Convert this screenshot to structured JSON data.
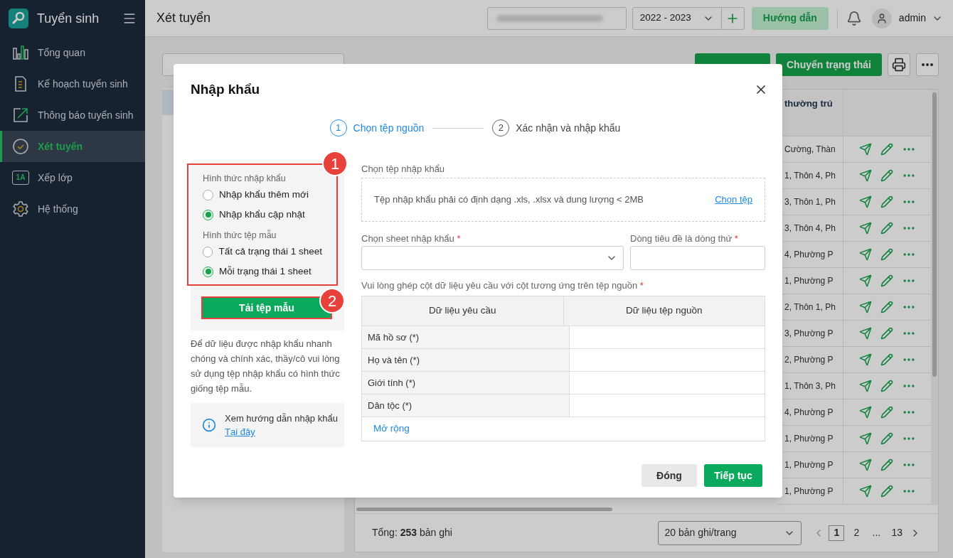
{
  "sidebar": {
    "brand": "Tuyển sinh",
    "items": [
      {
        "label": "Tổng quan",
        "selected": false
      },
      {
        "label": "Kế hoạch tuyển sinh",
        "selected": false
      },
      {
        "label": "Thông báo tuyển sinh",
        "selected": false
      },
      {
        "label": "Xét tuyển",
        "selected": true
      },
      {
        "label": "Xếp lớp",
        "icon_text": "1A",
        "selected": false
      },
      {
        "label": "Hệ thống",
        "selected": false
      }
    ]
  },
  "header": {
    "title": "Xét tuyển",
    "year": "2022 - 2023",
    "guide_button": "Hướng dẫn",
    "user": "admin"
  },
  "toolbar": {
    "status_button": "Chuyển trạng thái"
  },
  "table": {
    "column_header": "thường trú",
    "rows": [
      {
        "address": "Cường, Thàn"
      },
      {
        "address": "1, Thôn 4, Ph"
      },
      {
        "address": "3, Thôn 1, Ph"
      },
      {
        "address": "3, Thôn 4, Ph"
      },
      {
        "address": "4, Phường P"
      },
      {
        "address": "1, Phường P"
      },
      {
        "address": "2, Thôn 1, Ph"
      },
      {
        "address": "3, Phường P"
      },
      {
        "address": "2, Phường P"
      },
      {
        "address": "1, Thôn 3, Ph"
      },
      {
        "address": "4, Phường P"
      },
      {
        "address": "1, Phường P"
      },
      {
        "address": "1, Phường P"
      },
      {
        "address": "1, Phường P"
      }
    ]
  },
  "footer": {
    "total": "Tổng: **253** bản ghi",
    "page_size": "20 bản ghi/trang",
    "pages": [
      {
        "label": "1",
        "selected": true
      },
      {
        "label": "2",
        "selected": false
      },
      {
        "label": "...",
        "selected": false
      },
      {
        "label": "13",
        "selected": false
      }
    ]
  },
  "modal": {
    "title": "Nhập khẩu",
    "steps": [
      {
        "number": "1",
        "label": "Chọn tệp nguồn",
        "selected": true
      },
      {
        "number": "2",
        "label": "Xác nhận và nhập khẩu",
        "selected": false
      }
    ],
    "option_groups": [
      {
        "title": "Hình thức nhập khẩu",
        "options": [
          {
            "label": "Nhập khẩu thêm mới",
            "selected": false
          },
          {
            "label": "Nhập khẩu cập nhật",
            "selected": true
          }
        ]
      },
      {
        "title": "Hình thức tệp mẫu",
        "options": [
          {
            "label": "Tất cả trạng thái 1 sheet",
            "selected": false
          },
          {
            "label": "Mỗi trạng thái 1 sheet",
            "selected": true
          }
        ]
      }
    ],
    "callouts": [
      "1",
      "2"
    ],
    "template_button": "Tải tệp mẫu",
    "note": "Để dữ liệu được nhập khẩu nhanh chóng và chính xác, thầy/cô vui lòng sử dụng tệp nhập khẩu có hình thức giống tệp mẫu.",
    "help": {
      "text": "Xem hướng dẫn nhập khẩu",
      "link": "Tại đây"
    },
    "file": {
      "label": "Chọn tệp nhập khẩu",
      "hint": "Tệp nhập khẩu phải có định dạng .xls, .xlsx và dung lượng < 2MB",
      "link": "Chọn tệp"
    },
    "sheet_field": {
      "label": "Chọn sheet nhập khẩu",
      "required_mark": "*"
    },
    "header_row_field": {
      "label": "Dòng tiêu đề là dòng thứ",
      "required_mark": "*"
    },
    "mapping": {
      "instruction": "Vui lòng ghép cột dữ liệu yêu cầu với cột tương ứng trên tệp nguồn",
      "required_mark": "*",
      "columns": [
        "Dữ liệu yêu cầu",
        "Dữ liệu tệp nguồn"
      ],
      "rows": [
        {
          "required": "Mã hồ sơ (*)"
        },
        {
          "required": "Họ và tên (*)"
        },
        {
          "required": "Giới tính (*)"
        },
        {
          "required": "Dân tộc (*)"
        }
      ],
      "expand_link": "Mở rộng"
    },
    "buttons": {
      "close": "Đóng",
      "next": "Tiếp tục"
    }
  }
}
